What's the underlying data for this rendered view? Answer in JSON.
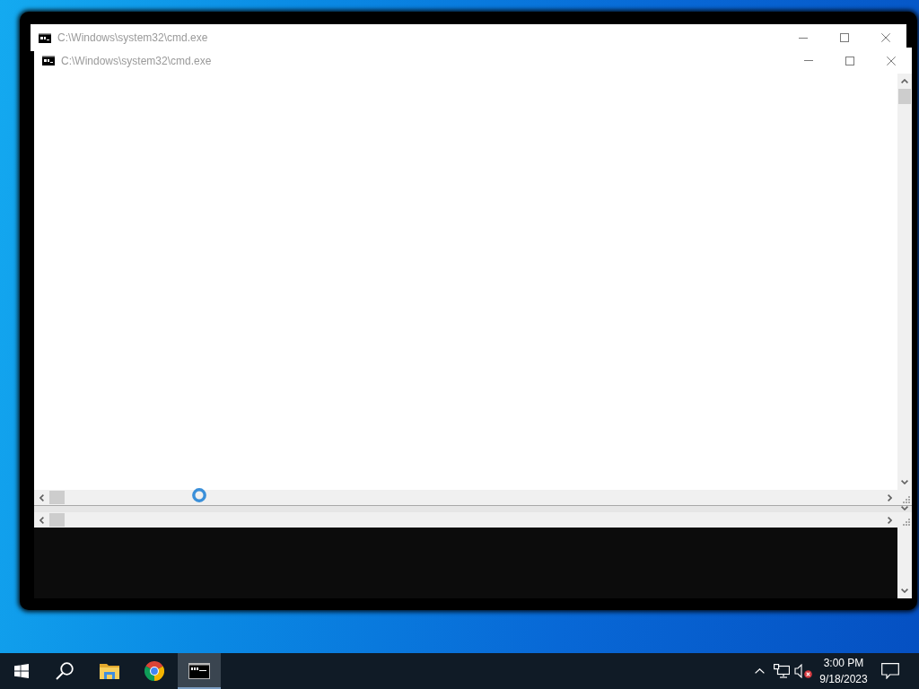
{
  "windows": [
    {
      "title": "C:\\Windows\\system32\\cmd.exe"
    },
    {
      "title": "C:\\Windows\\system32\\cmd.exe"
    }
  ],
  "taskbar": {
    "buttons": [
      {
        "kind": "start",
        "selected": false
      },
      {
        "kind": "search",
        "selected": false
      },
      {
        "kind": "folder",
        "selected": false
      },
      {
        "kind": "browser",
        "selected": false
      },
      {
        "kind": "console",
        "selected": true
      }
    ],
    "clock": {
      "time": "3:00 PM",
      "date": "9/18/2023"
    }
  }
}
